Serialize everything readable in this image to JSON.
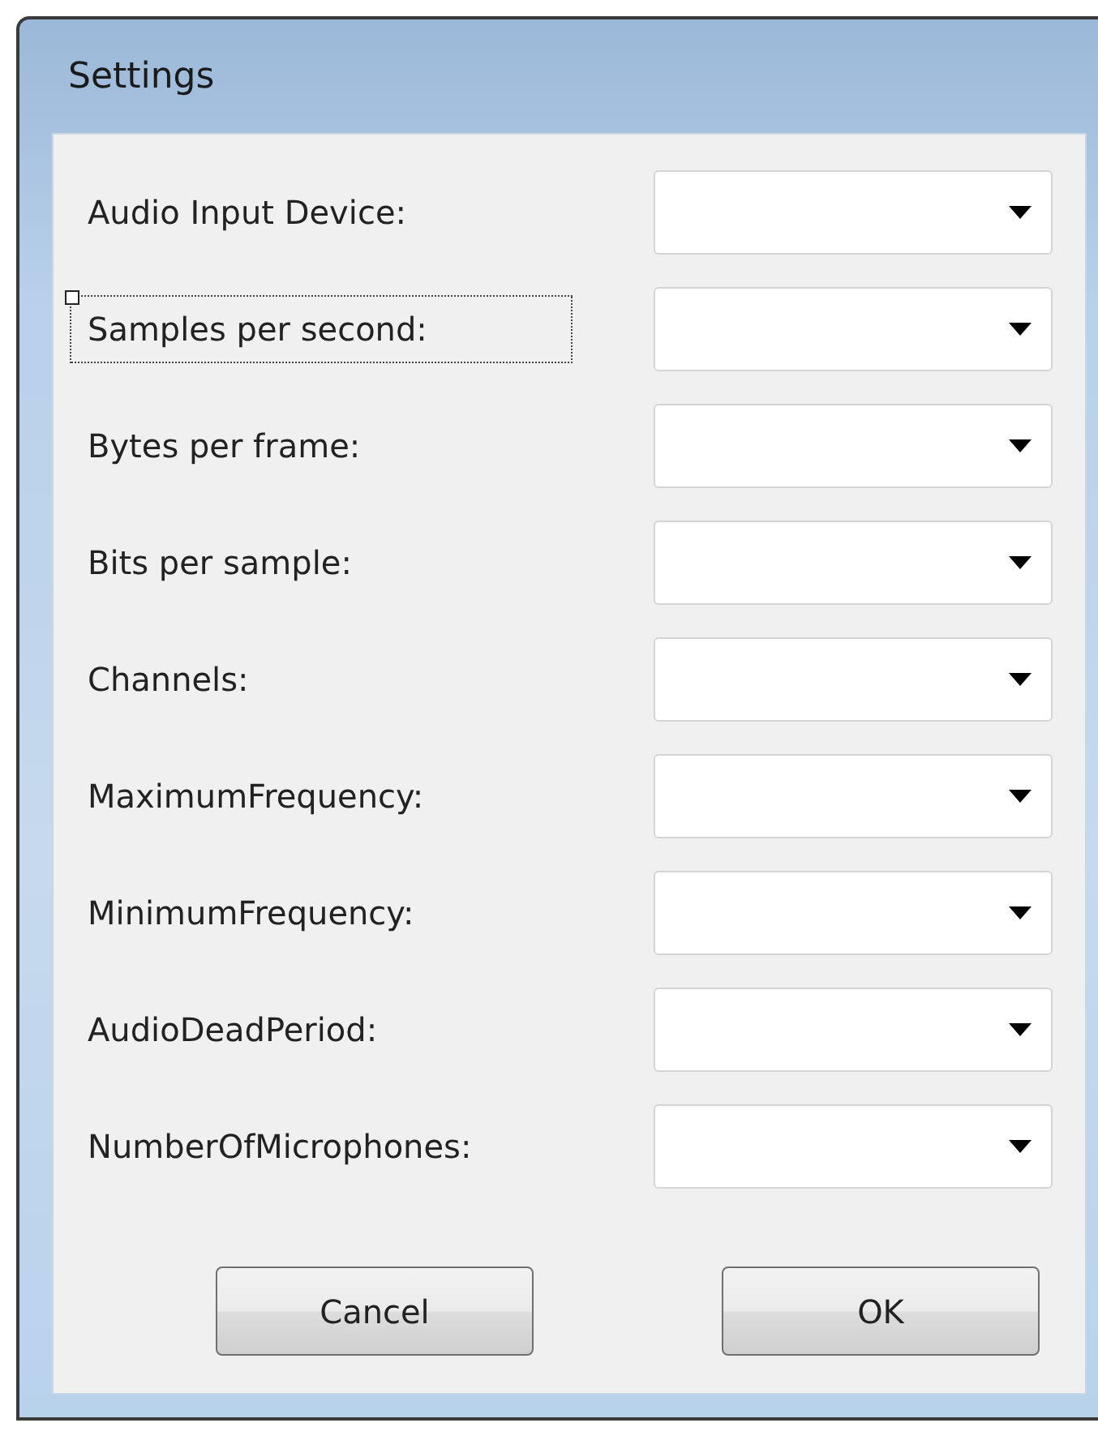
{
  "window": {
    "title": "Settings"
  },
  "fields": [
    {
      "label": "Audio Input Device:",
      "focused": false
    },
    {
      "label": "Samples per second:",
      "focused": true
    },
    {
      "label": "Bytes per frame:",
      "focused": false
    },
    {
      "label": "Bits per sample:",
      "focused": false
    },
    {
      "label": "Channels:",
      "focused": false
    },
    {
      "label": "MaximumFrequency:",
      "focused": false
    },
    {
      "label": "MinimumFrequency:",
      "focused": false
    },
    {
      "label": "AudioDeadPeriod:",
      "focused": false
    },
    {
      "label": "NumberOfMicrophones:",
      "focused": false
    }
  ],
  "buttons": [
    {
      "label": "Cancel"
    },
    {
      "label": "OK"
    }
  ]
}
